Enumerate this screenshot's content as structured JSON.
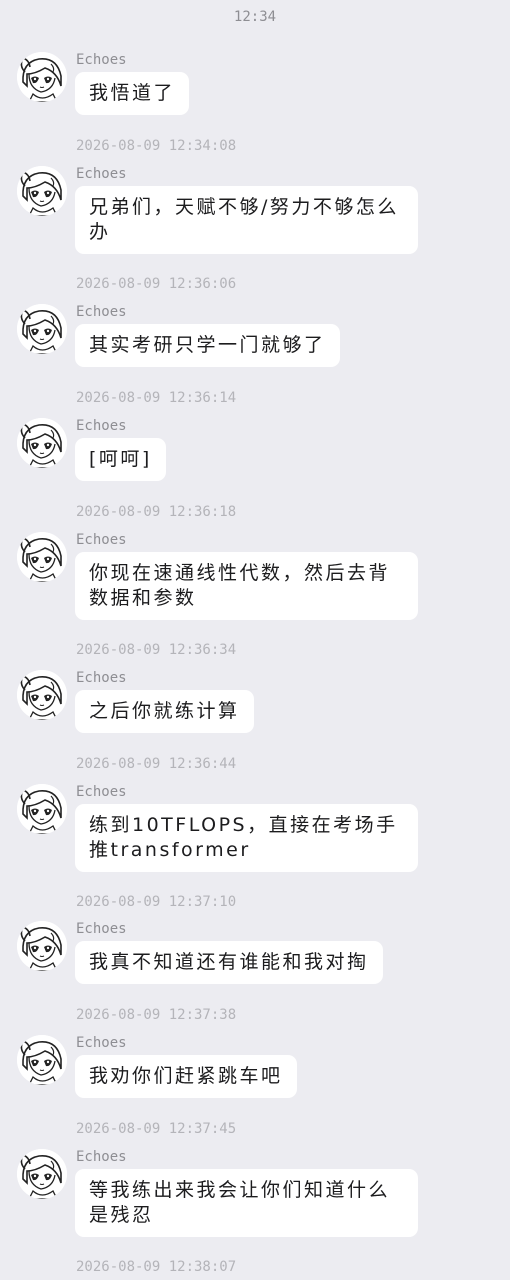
{
  "header": {
    "time": "12:34"
  },
  "messages": [
    {
      "sender": "Echoes",
      "text": "我悟道了",
      "timestamp": "2026-08-09 12:34:08"
    },
    {
      "sender": "Echoes",
      "text": "兄弟们，天赋不够/努力不够怎么办",
      "timestamp": "2026-08-09 12:36:06"
    },
    {
      "sender": "Echoes",
      "text": "其实考研只学一门就够了",
      "timestamp": "2026-08-09 12:36:14"
    },
    {
      "sender": "Echoes",
      "text": "[呵呵]",
      "timestamp": "2026-08-09 12:36:18"
    },
    {
      "sender": "Echoes",
      "text": "你现在速通线性代数，然后去背数据和参数",
      "timestamp": "2026-08-09 12:36:34"
    },
    {
      "sender": "Echoes",
      "text": "之后你就练计算",
      "timestamp": "2026-08-09 12:36:44"
    },
    {
      "sender": "Echoes",
      "text": "练到10TFLOPS，直接在考场手推transformer",
      "timestamp": "2026-08-09 12:37:10"
    },
    {
      "sender": "Echoes",
      "text": "我真不知道还有谁能和我对掏",
      "timestamp": "2026-08-09 12:37:38"
    },
    {
      "sender": "Echoes",
      "text": "我劝你们赶紧跳车吧",
      "timestamp": "2026-08-09 12:37:45"
    },
    {
      "sender": "Echoes",
      "text": "等我练出来我会让你们知道什么是残忍",
      "timestamp": "2026-08-09 12:38:07"
    }
  ]
}
